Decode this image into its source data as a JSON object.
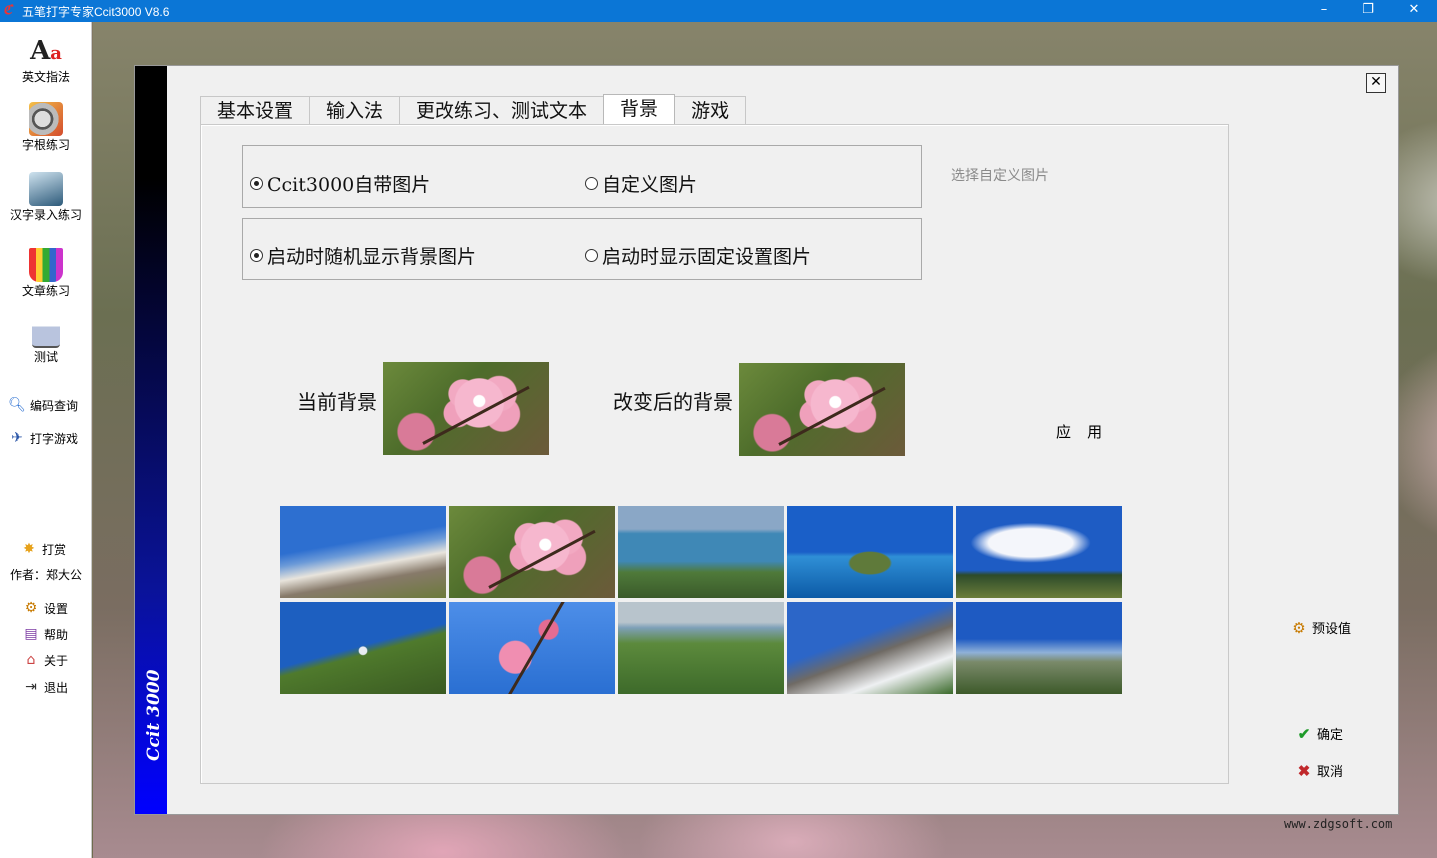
{
  "window": {
    "title": "五笔打字专家Ccit3000 V8.6",
    "minimize": "–",
    "restore": "❐",
    "close": "✕"
  },
  "sidebar": {
    "items": [
      {
        "label": "英文指法",
        "icon": "letters-aa-icon"
      },
      {
        "label": "字根练习",
        "icon": "film-reel-icon"
      },
      {
        "label": "汉字录入练习",
        "icon": "typing-person-icon"
      },
      {
        "label": "文章练习",
        "icon": "pencil-cup-icon"
      },
      {
        "label": "测试",
        "icon": "podium-icon"
      }
    ],
    "tools": [
      {
        "label": "编码查询",
        "icon": "magnifier-icon"
      },
      {
        "label": "打字游戏",
        "icon": "joystick-icon"
      }
    ],
    "donate": "打赏",
    "author": "作者：郑大公",
    "menu": [
      {
        "label": "设置",
        "icon": "gear-icon"
      },
      {
        "label": "帮助",
        "icon": "book-icon"
      },
      {
        "label": "关于",
        "icon": "house-icon"
      },
      {
        "label": "退出",
        "icon": "exit-icon"
      }
    ]
  },
  "dialog": {
    "close": "✕",
    "brand": "Ccit 3000",
    "tabs": [
      "基本设置",
      "输入法",
      "更改练习、测试文本",
      "背景",
      "游戏"
    ],
    "active_tab": "背景",
    "source_group": {
      "builtin": "Ccit3000自带图片",
      "custom": "自定义图片",
      "selected": "builtin"
    },
    "choose_custom": "选择自定义图片",
    "startup_group": {
      "random": "启动时随机显示背景图片",
      "fixed": "启动时显示固定设置图片",
      "selected": "random"
    },
    "current_bg_label": "当前背景",
    "changed_bg_label": "改变后的背景",
    "apply": "应 用",
    "preset": "预设值",
    "ok": "确定",
    "cancel": "取消"
  },
  "watermark": "www.zdgsoft.com"
}
